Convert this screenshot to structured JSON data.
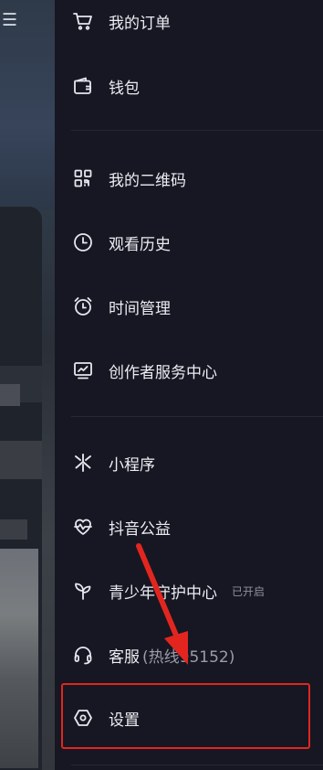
{
  "left": {
    "menu_icon": "hamburger-menu-icon"
  },
  "drawer": {
    "items": [
      {
        "label": "我的订单",
        "icon": "shopping-cart-icon"
      },
      {
        "label": "钱包",
        "icon": "wallet-icon"
      },
      {
        "label": "我的二维码",
        "icon": "qr-code-icon"
      },
      {
        "label": "观看历史",
        "icon": "clock-icon"
      },
      {
        "label": "时间管理",
        "icon": "alarm-clock-icon"
      },
      {
        "label": "创作者服务中心",
        "icon": "creator-chart-icon"
      },
      {
        "label": "小程序",
        "icon": "mini-program-icon"
      },
      {
        "label": "抖音公益",
        "icon": "charity-heart-icon"
      },
      {
        "label": "青少年守护中心",
        "icon": "sprout-icon",
        "badge": "已开启"
      },
      {
        "label": "客服",
        "sub": "(热线95152)",
        "icon": "headset-icon"
      },
      {
        "label": "设置",
        "icon": "settings-hexagon-icon"
      }
    ]
  },
  "colors": {
    "highlight": "#e2261f",
    "arrow": "#e2261f",
    "background": "#161722"
  }
}
